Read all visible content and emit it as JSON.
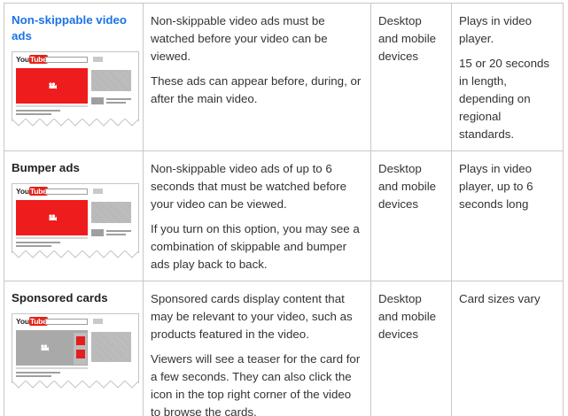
{
  "rows": [
    {
      "name": "Non-skippable video ads",
      "name_is_link": true,
      "description": [
        "Non-skippable video ads must be watched before your video can be viewed.",
        "These ads can appear before, during, or after the main video."
      ],
      "devices": "Desktop and mobile devices",
      "details": [
        "Plays in video player.",
        "15 or 20 seconds in length, depending on regional standards."
      ],
      "illustration": {
        "logo_you": "You",
        "logo_tube": "Tube",
        "video_color": "#ee1c1c",
        "variant": "video-ad"
      }
    },
    {
      "name": "Bumper ads",
      "name_is_link": false,
      "description": [
        "Non-skippable video ads of up to 6 seconds that must be watched before your video can be viewed.",
        "If you turn on this option, you may see a combination of skippable and bumper ads play back to back."
      ],
      "devices": "Desktop and mobile devices",
      "details": [
        "Plays in video player, up to 6 seconds long"
      ],
      "illustration": {
        "logo_you": "You",
        "logo_tube": "Tube",
        "video_color": "#ee1c1c",
        "variant": "video-ad"
      }
    },
    {
      "name": "Sponsored cards",
      "name_is_link": false,
      "description": [
        "Sponsored cards display content that may be relevant to your video, such as products featured in the video.",
        "Viewers will see a teaser for the card for a few seconds. They can also click the icon in the top right corner of the video to browse the cards."
      ],
      "devices": "Desktop and mobile devices",
      "details": [
        "Card sizes vary"
      ],
      "illustration": {
        "logo_you": "You",
        "logo_tube": "Tube",
        "video_color": "#a9a9a9",
        "variant": "cards"
      }
    }
  ],
  "colors": {
    "link": "#1a73e8",
    "border": "#c8c8c8",
    "youtube_red": "#e62117"
  }
}
